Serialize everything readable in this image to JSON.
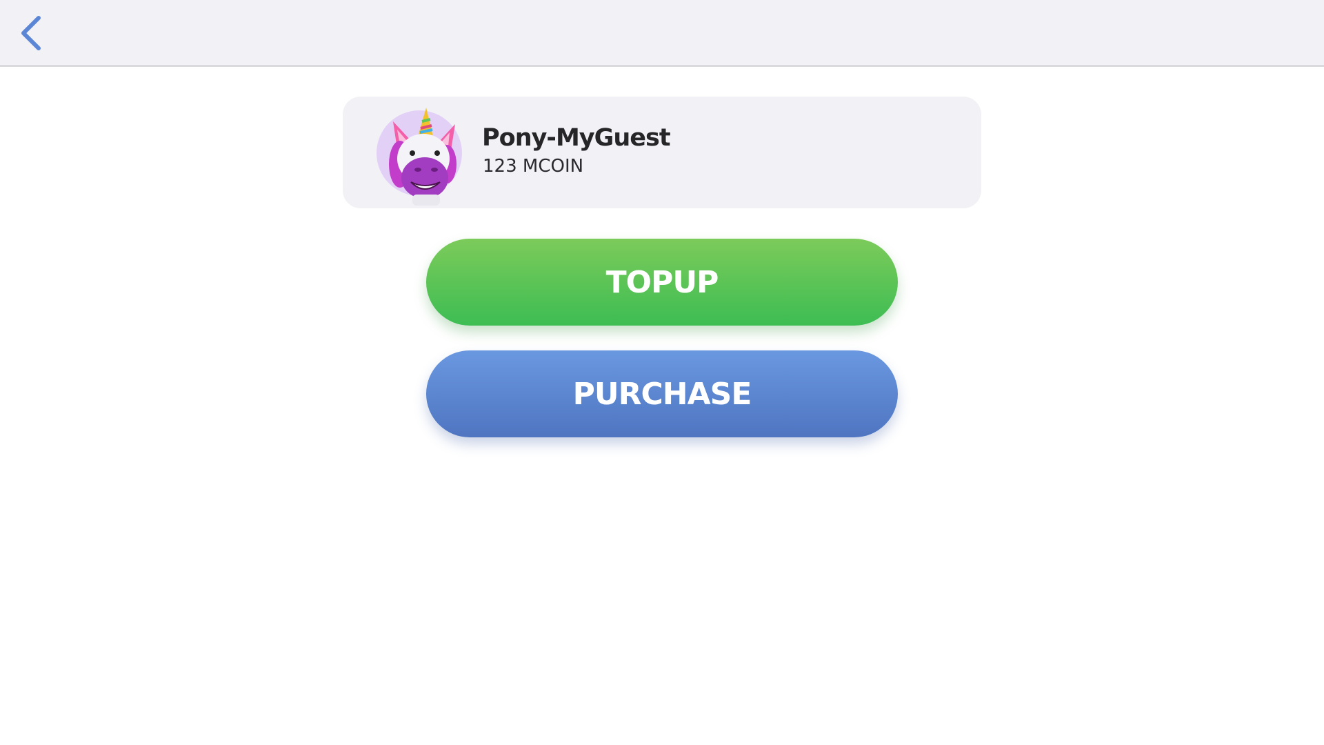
{
  "header": {
    "back_icon": "chevron-left-icon",
    "accent_color": "#5b86d6"
  },
  "profile": {
    "avatar_icon": "unicorn-avatar-icon",
    "name": "Pony-MyGuest",
    "balance": "123 MCOIN"
  },
  "actions": {
    "topup_label": "TOPUP",
    "topup_color": "#47c054",
    "purchase_label": "PURCHASE",
    "purchase_color": "#5b81cc"
  }
}
